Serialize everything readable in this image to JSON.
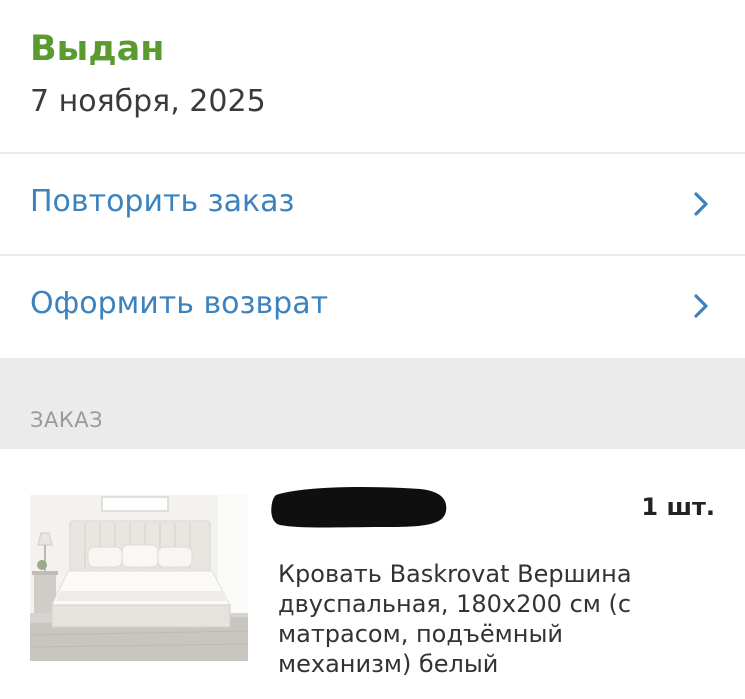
{
  "status": {
    "title": "Выдан",
    "date": "7 ноября, 2025",
    "color": "#5b9a2f"
  },
  "actions": [
    {
      "label": "Повторить заказ",
      "icon": "chevron-right-icon"
    },
    {
      "label": "Оформить возврат",
      "icon": "chevron-right-icon"
    }
  ],
  "order_section": {
    "label": "ЗАКАЗ"
  },
  "order_item": {
    "quantity": "1 шт.",
    "title": "Кровать Baskrovat Вершина\nдвуспальная, 180х200 см (с\nматрасом, подъёмный\nмеханизм) белый",
    "image": "bed-photo"
  },
  "colors": {
    "link": "#3b82bf",
    "status": "#5b9a2f",
    "section_bg": "#ebebeb"
  }
}
